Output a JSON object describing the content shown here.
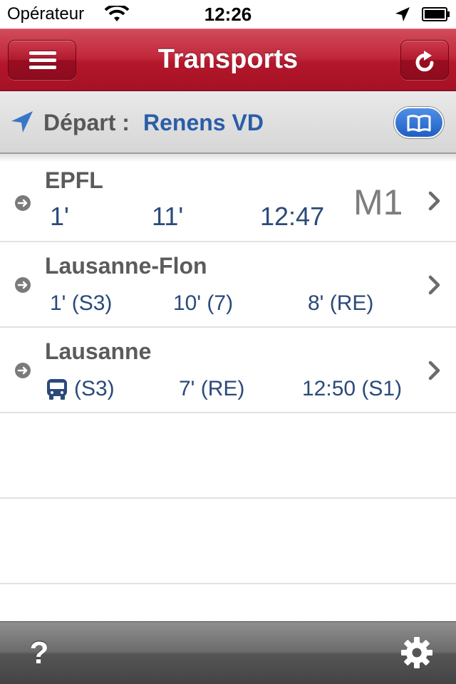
{
  "status_bar": {
    "carrier": "Opérateur",
    "time": "12:26"
  },
  "nav": {
    "title": "Transports"
  },
  "departure": {
    "label": "Départ :",
    "station": "Renens VD"
  },
  "rows": [
    {
      "name": "EPFL",
      "times": [
        "1'",
        "11'",
        "12:47"
      ],
      "line": "M1"
    },
    {
      "name": "Lausanne-Flon",
      "times": [
        "1' (S3)",
        "10' (7)",
        "8' (RE)"
      ]
    },
    {
      "name": "Lausanne",
      "first_suffix": "(S3)",
      "times": [
        "7' (RE)",
        "12:50 (S1)"
      ]
    }
  ],
  "toolbar": {
    "help": "?"
  },
  "colors": {
    "nav_red": "#b3172b",
    "link_blue": "#2b5da8",
    "time_blue": "#2b4a7a",
    "gray_text": "#5b5b5b"
  }
}
